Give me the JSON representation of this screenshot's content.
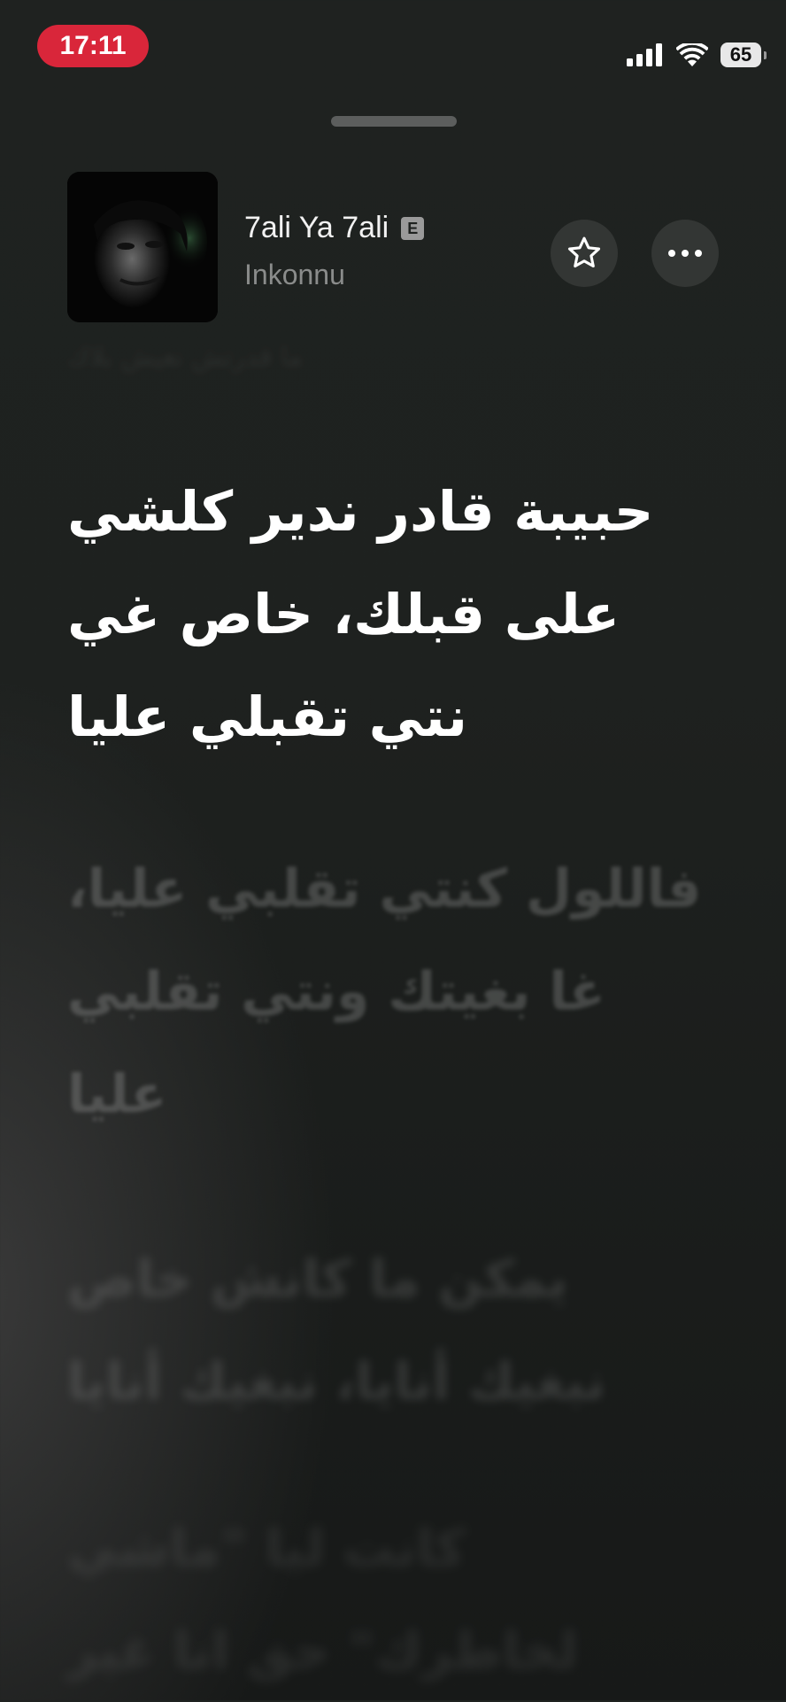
{
  "status_bar": {
    "time": "17:11",
    "battery": "65",
    "signal_icon": "cellular-signal-icon",
    "wifi_icon": "wifi-icon"
  },
  "track": {
    "title": "7ali Ya 7ali",
    "explicit_badge": "E",
    "artist": "Inkonnu",
    "artwork_icon": "album-artwork"
  },
  "controls": {
    "favorite_icon": "star-icon",
    "more_icon": "more-icon"
  },
  "lyrics": {
    "previous": "ما قدرتش نعيش بلاك",
    "active": [
      "حبيبة قادر ندير كلشي",
      "على قبلك، خاص غي",
      "نتي تقبلي عليا"
    ],
    "next": [
      "فاللول كنتي تقلبي عليا،",
      "غا بغيتك ونتي تقلبي",
      "عليا"
    ],
    "upcoming_1": [
      "يمكن ما كانش خاص",
      "نبغيك أنايا، نبغيك أنايا"
    ],
    "upcoming_2": [
      "كانت ليا \"ماشي",
      "لخاطرك\" حق انا غير"
    ]
  },
  "colors": {
    "time_pill": "#d9263a",
    "background": "#1f2220",
    "active_text": "#ffffff",
    "secondary_text": "#8a8c8b"
  }
}
